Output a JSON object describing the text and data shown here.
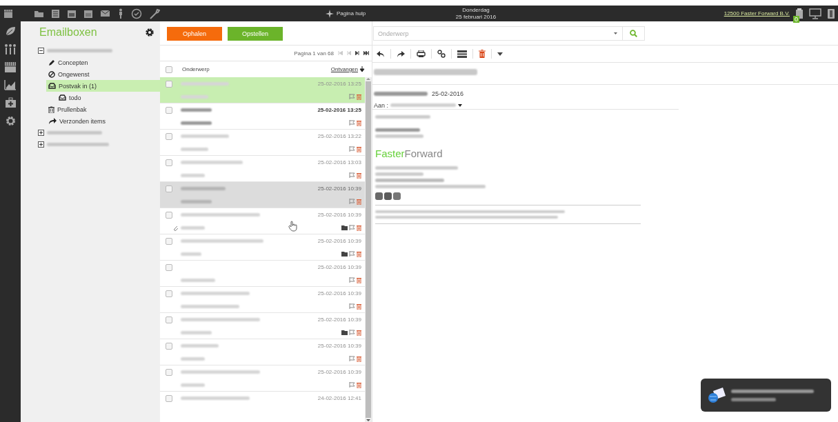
{
  "topbar": {
    "help": "Pagina hulp",
    "day": "Donderdag",
    "date": "25 februari 2016",
    "company": "12500 Faster Forward B.V.",
    "cart_count": "0"
  },
  "sidebar": {
    "title": "Emailboxen",
    "accounts": [
      {
        "expanded": true,
        "children": [
          {
            "kind": "drafts",
            "label": "Concepten",
            "selected": false
          },
          {
            "kind": "junk",
            "label": "Ongewenst",
            "selected": false
          },
          {
            "kind": "inbox",
            "label": "Postvak in (1)",
            "selected": true,
            "children": [
              {
                "kind": "inbox",
                "label": "todo",
                "selected": false
              }
            ]
          },
          {
            "kind": "trash",
            "label": "Prullenbak",
            "selected": false
          },
          {
            "kind": "sent",
            "label": "Verzonden items",
            "selected": false
          }
        ]
      },
      {
        "expanded": false
      },
      {
        "expanded": false
      }
    ]
  },
  "actions": {
    "fetch": "Ophalen",
    "compose": "Opstellen"
  },
  "pager": {
    "label": "Pagina 1 van 68"
  },
  "list": {
    "columns": [
      "Onderwerp",
      "Ontvangen"
    ],
    "all_checked": false,
    "rows": [
      {
        "date": "25-02-2016 13:25",
        "selected": true,
        "unread": false,
        "hovered": false,
        "attachment": false,
        "folder": false,
        "checked": false
      },
      {
        "date": "25-02-2016 13:25",
        "selected": false,
        "unread": true,
        "hovered": false,
        "attachment": false,
        "folder": false,
        "checked": false
      },
      {
        "date": "25-02-2016 13:22",
        "selected": false,
        "unread": false,
        "hovered": false,
        "attachment": false,
        "folder": false,
        "checked": false
      },
      {
        "date": "25-02-2016 13:03",
        "selected": false,
        "unread": false,
        "hovered": false,
        "attachment": false,
        "folder": false,
        "checked": false
      },
      {
        "date": "25-02-2016 10:39",
        "selected": false,
        "unread": false,
        "hovered": true,
        "attachment": false,
        "folder": false,
        "checked": false
      },
      {
        "date": "25-02-2016 10:39",
        "selected": false,
        "unread": false,
        "hovered": false,
        "attachment": true,
        "folder": true,
        "checked": false
      },
      {
        "date": "25-02-2016 10:39",
        "selected": false,
        "unread": false,
        "hovered": false,
        "attachment": false,
        "folder": true,
        "checked": false
      },
      {
        "date": "25-02-2016 10:39",
        "selected": false,
        "unread": false,
        "hovered": false,
        "attachment": false,
        "folder": false,
        "checked": false
      },
      {
        "date": "25-02-2016 10:39",
        "selected": false,
        "unread": false,
        "hovered": false,
        "attachment": false,
        "folder": false,
        "checked": false
      },
      {
        "date": "25-02-2016 10:39",
        "selected": false,
        "unread": false,
        "hovered": false,
        "attachment": false,
        "folder": true,
        "checked": false
      },
      {
        "date": "25-02-2016 10:39",
        "selected": false,
        "unread": false,
        "hovered": false,
        "attachment": false,
        "folder": false,
        "checked": false
      },
      {
        "date": "25-02-2016 10:39",
        "selected": false,
        "unread": false,
        "hovered": false,
        "attachment": false,
        "folder": false,
        "checked": false
      },
      {
        "date": "24-02-2016 12:41",
        "selected": false,
        "unread": false,
        "hovered": false,
        "checked": false
      }
    ]
  },
  "reader": {
    "search_placeholder": "Onderwerp",
    "date": "25-02-2016",
    "to_label": "Aan :",
    "logo_first": "Faster",
    "logo_second": "Forward"
  }
}
